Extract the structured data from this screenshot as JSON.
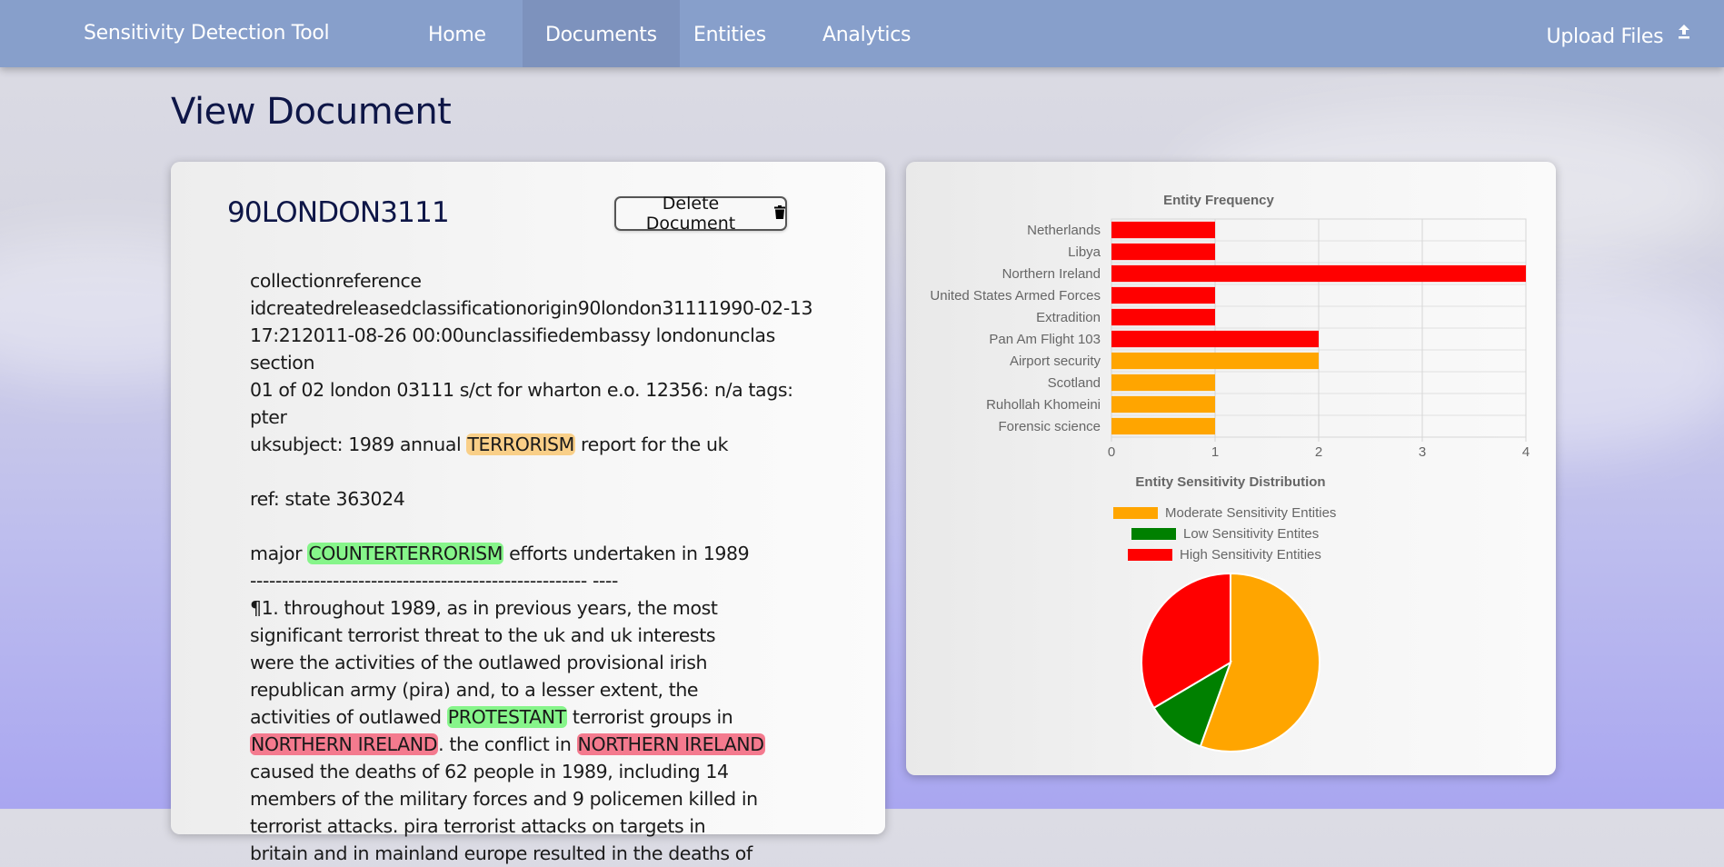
{
  "navbar": {
    "brand": "Sensitivity Detection Tool",
    "links": [
      "Home",
      "Documents",
      "Entities",
      "Analytics"
    ],
    "active_link": "Documents",
    "upload_label": "Upload Files",
    "upload_icon": "upload-icon"
  },
  "page": {
    "title": "View Document"
  },
  "document": {
    "name": "90LONDON3111",
    "delete_label": "Delete Document",
    "delete_icon": "trash-icon",
    "body": [
      [
        {
          "t": "collectionreference"
        },
        {
          "br": true
        },
        {
          "t": "idcreatedreleasedclassificationorigin90london31111990-02-13"
        },
        {
          "br": true
        },
        {
          "t": "17:212011-08-26 00:00unclassifiedembassy londonunclas section"
        },
        {
          "br": true
        },
        {
          "t": "01 of 02 london 03111 s/ct for wharton e.o. 12356: n/a tags: pter"
        },
        {
          "br": true
        },
        {
          "t": "uksubject: 1989 annual "
        },
        {
          "t": "TERRORISM",
          "hl": "moderate"
        },
        {
          "t": " report for the uk"
        }
      ],
      [
        {
          "t": "ref: state 363024"
        }
      ],
      [
        {
          "t": "major "
        },
        {
          "t": "COUNTERTERRORISM",
          "hl": "low"
        },
        {
          "t": " efforts undertaken in 1989"
        },
        {
          "br": true
        },
        {
          "t": "----------------------------------------------------- ----"
        },
        {
          "br": true
        },
        {
          "t": "¶1. throughout 1989, as in previous years, the most"
        },
        {
          "br": true
        },
        {
          "t": "significant terrorist threat to the uk and uk interests"
        },
        {
          "br": true
        },
        {
          "t": "were the activities of the outlawed provisional irish"
        },
        {
          "br": true
        },
        {
          "t": "republican army (pira) and, to a lesser extent, the"
        },
        {
          "br": true
        },
        {
          "t": "activities of outlawed "
        },
        {
          "t": "PROTESTANT",
          "hl": "low"
        },
        {
          "t": " terrorist groups in"
        },
        {
          "br": true
        },
        {
          "t": "NORTHERN IRELAND",
          "hl": "high"
        },
        {
          "t": ". the conflict in "
        },
        {
          "t": "NORTHERN IRELAND",
          "hl": "high"
        },
        {
          "br": true
        },
        {
          "t": "caused the deaths of 62 people in 1989, including 14"
        },
        {
          "br": true
        },
        {
          "t": "members of the military forces and 9 policemen killed in"
        },
        {
          "br": true
        },
        {
          "t": "terrorist attacks. pira terrorist attacks on targets in"
        },
        {
          "br": true
        },
        {
          "t": "britain and in mainland europe resulted in the deaths of"
        }
      ]
    ]
  },
  "colors": {
    "high": "#ff0000",
    "moderate": "#ffa500",
    "low": "#008000",
    "highlight_high": "#f47a8e",
    "highlight_moderate": "#f9cf88",
    "highlight_low": "#86f58a"
  },
  "chart_data": [
    {
      "type": "bar",
      "orientation": "horizontal",
      "title": "Entity Frequency",
      "categories": [
        "Netherlands",
        "Libya",
        "Northern Ireland",
        "United States Armed Forces",
        "Extradition",
        "Pan Am Flight 103",
        "Airport security",
        "Scotland",
        "Ruhollah Khomeini",
        "Forensic science"
      ],
      "values": [
        1,
        1,
        4,
        1,
        1,
        2,
        2,
        1,
        1,
        1
      ],
      "bar_levels": [
        "high",
        "high",
        "high",
        "high",
        "high",
        "high",
        "moderate",
        "moderate",
        "moderate",
        "moderate"
      ],
      "xlim": [
        0,
        4
      ],
      "xticks": [
        0,
        1,
        2,
        3,
        4
      ],
      "grid": true
    },
    {
      "type": "pie",
      "title": "Entity Sensitivity Distribution",
      "legend": [
        {
          "label": "Moderate Sensitivity Entities",
          "level": "moderate"
        },
        {
          "label": "Low Sensitivity Entites",
          "level": "low"
        },
        {
          "label": "High Sensitivity Entities",
          "level": "high"
        }
      ],
      "legend_position": "top",
      "slices": [
        {
          "level": "moderate",
          "fraction": 0.555
        },
        {
          "level": "low",
          "fraction": 0.11
        },
        {
          "level": "high",
          "fraction": 0.335
        }
      ]
    }
  ]
}
